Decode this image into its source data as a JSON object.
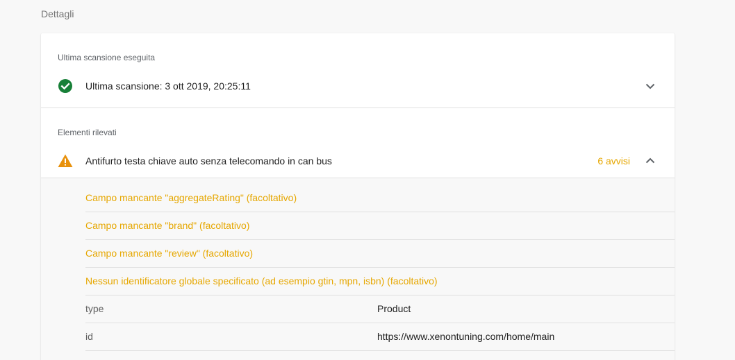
{
  "section": {
    "title": "Dettagli"
  },
  "last_crawl": {
    "label": "Ultima scansione eseguita",
    "text": "Ultima scansione: 3 ott 2019, 20:25:11",
    "status_icon": "check-circle-icon",
    "status_color": "#188038"
  },
  "detected": {
    "label": "Elementi rilevati",
    "item_title": "Antifurto testa chiave auto senza telecomando in can bus",
    "warning_count": "6 avvisi",
    "warning_color": "#e6a700",
    "warnings": [
      "Campo mancante \"aggregateRating\" (facoltativo)",
      "Campo mancante \"brand\" (facoltativo)",
      "Campo mancante \"review\" (facoltativo)",
      "Nessun identificatore globale specificato (ad esempio gtin, mpn, isbn) (facoltativo)"
    ],
    "properties": [
      {
        "name": "type",
        "value": "Product"
      },
      {
        "name": "id",
        "value": "https://www.xenontuning.com/home/main"
      }
    ]
  }
}
